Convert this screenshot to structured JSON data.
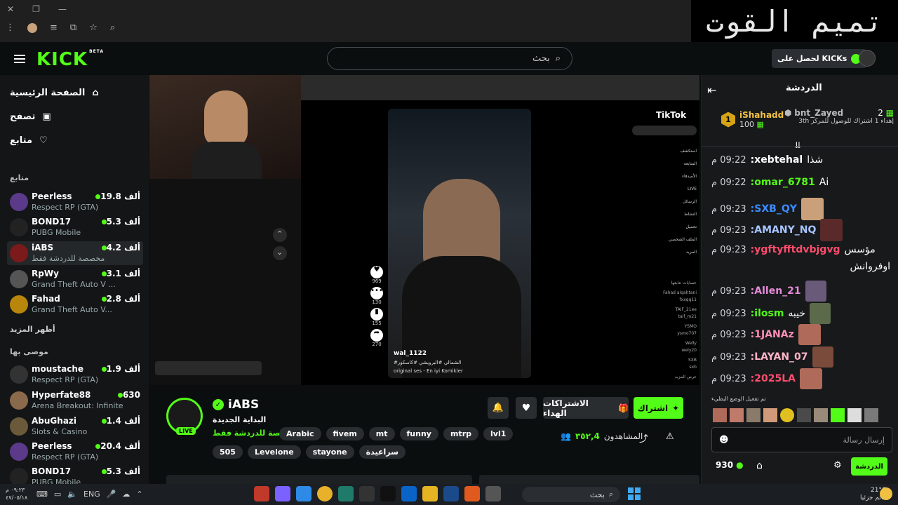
{
  "browser": {
    "overlay_text": "تميم القوت"
  },
  "header": {
    "logo": "KICK",
    "logo_badge": "BETA",
    "search_placeholder": "بحث",
    "kicks_button": "لحصل على KICKs"
  },
  "sidebar": {
    "nav": [
      {
        "label": "الصفحة الرئيسية",
        "icon": "home-icon"
      },
      {
        "label": "تصفح",
        "icon": "browse-icon"
      },
      {
        "label": "متابع",
        "icon": "heart-icon"
      }
    ],
    "following_title": "متابع",
    "following": [
      {
        "name": "Peerless",
        "category": "Respect RP (GTA)",
        "viewers": "19.8 ألف"
      },
      {
        "name": "BOND17",
        "category": "PUBG Mobile",
        "viewers": "5.3 ألف"
      },
      {
        "name": "iABS",
        "category": "مخصصة للدردشة فقط",
        "viewers": "4.2 ألف"
      },
      {
        "name": "RpWy",
        "category": "Grand Theft Auto V ...",
        "viewers": "3.1 ألف"
      },
      {
        "name": "Fahad",
        "category": "Grand Theft Auto V...",
        "viewers": "2.8 ألف"
      }
    ],
    "show_more": "أظهر المزيد",
    "recommended_title": "موصى بها",
    "recommended": [
      {
        "name": "moustache",
        "category": "Respect RP (GTA)",
        "viewers": "1.9 ألف"
      },
      {
        "name": "Hyperfate88",
        "category": "Arena Breakout: Infinite",
        "viewers": "630"
      },
      {
        "name": "AbuGhazi",
        "category": "Slots & Casino",
        "viewers": "1.4 ألف"
      },
      {
        "name": "Peerless",
        "category": "Respect RP (GTA)",
        "viewers": "20.4 ألف"
      },
      {
        "name": "BOND17",
        "category": "PUBG Mobile",
        "viewers": "5.3 ألف"
      }
    ]
  },
  "video": {
    "tiktok_logo": "TikTok",
    "tiktok_user": "wal_1122",
    "tiktok_caption": "#الشمالي #البرويشي #كاسكور",
    "tiktok_sound": "original ses - En iyi Komikler",
    "tiktok_counts": [
      "969",
      "130",
      "155",
      "270"
    ],
    "live_badge": "LIVE",
    "side_items": [
      "استكشف",
      "المتابعة",
      "الأصدقاء",
      "LIVE",
      "الرسائل",
      "النشاط",
      "تحميل",
      "الملف الشخصي",
      "المزيد"
    ],
    "following_accounts_title": "حسابات تتابعها",
    "following_accounts": [
      {
        "name": "Fahad alqahtani",
        "handle": "fxxqq11"
      },
      {
        "name": "TAIF_21ee",
        "handle": "taif_m21"
      },
      {
        "name": "YSMO",
        "handle": "ysmo707"
      },
      {
        "name": "Welly",
        "handle": "wely20"
      },
      {
        "name": "SXB",
        "handle": "sxb"
      }
    ],
    "see_more": "عرض المزيد"
  },
  "stream": {
    "channel_name": "iABS",
    "stream_title": "البداية الجديدة",
    "category": "مخصصة للدردشة فقط",
    "live": "LIVE",
    "tags_row1": [
      "Arabic",
      "fivem",
      "mt",
      "funny",
      "mtrp",
      "lvl1"
    ],
    "tags_row2": [
      "505",
      "Levelone",
      "stayone",
      "سراعيدة"
    ],
    "viewers_label": "المشاهدون",
    "viewers_value": "4,٣٥٢",
    "subscribe_label": "اشتراك",
    "gift_label": "الاشتراكات الهداء"
  },
  "chat": {
    "title": "الدردشة",
    "leaderboard": [
      {
        "name": "iShahadd",
        "value": "100",
        "rank": "1"
      },
      {
        "name": "bnt_Zayed",
        "value": "2",
        "note": "إهداء 1 اشتراك للوصول للمركز 3th"
      }
    ],
    "messages": [
      {
        "time": "09:22 م",
        "user": "xebtehal:",
        "color": "#ffffff",
        "text": "شذا"
      },
      {
        "time": "09:22 م",
        "user": "omar_6781:",
        "color": "#53fc18",
        "text": "Ai"
      },
      {
        "time": "09:23 م",
        "user": "SXB_QY:",
        "color": "#3d8bff",
        "text": ""
      },
      {
        "time": "09:23 م",
        "user": "AMANY_NQ:",
        "color": "#a8c4ff",
        "text": ""
      },
      {
        "time": "09:23 م",
        "user": "ygftyfftdvbjgvg:",
        "color": "#ff4d6d",
        "text": "مؤسس"
      },
      {
        "time": "",
        "user": "",
        "color": "#ffffff",
        "text": "اوفروانش"
      },
      {
        "time": "09:23 م",
        "user": "Allen_21:",
        "color": "#e58bd8",
        "text": ""
      },
      {
        "time": "09:23 م",
        "user": "ilosm:",
        "color": "#53fc18",
        "text": "خيبه"
      },
      {
        "time": "09:23 م",
        "user": "1JANAz:",
        "color": "#ff8fb3",
        "text": ""
      },
      {
        "time": "09:23 م",
        "user": "LAYAN_07:",
        "color": "#ffb3c7",
        "text": ""
      },
      {
        "time": "09:23 م",
        "user": "2025LA:",
        "color": "#ff4d6d",
        "text": ""
      }
    ],
    "emote_label": "تم تفعيل الوضع البطيء",
    "input_placeholder": "إرسال رسالة",
    "points": "930",
    "send_label": "الدردشة"
  },
  "taskbar": {
    "search": "بحث",
    "lang": "ENG",
    "time": "٠٩:٢٣ م",
    "date": "٤٧/٠٥/١٨",
    "weather": "21°C",
    "weather_desc": "غائم جزئيا"
  }
}
